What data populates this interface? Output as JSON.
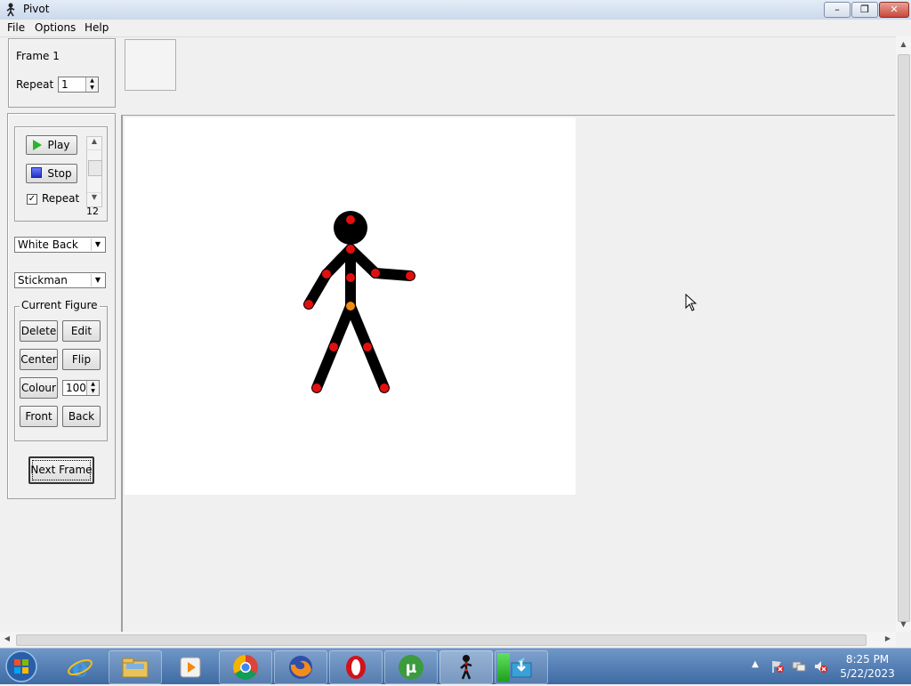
{
  "window": {
    "title": "Pivot"
  },
  "menu": {
    "items": [
      "File",
      "Options",
      "Help"
    ]
  },
  "frame_panel": {
    "frame_label": "Frame 1",
    "repeat_label": "Repeat :",
    "repeat_value": "1"
  },
  "playback": {
    "play_label": "Play",
    "stop_label": "Stop",
    "repeat_checkbox_label": "Repeat",
    "repeat_checked": true,
    "speed_value": "12"
  },
  "background_select": {
    "selected": "White Back"
  },
  "figure_type_select": {
    "selected": "Stickman"
  },
  "current_figure": {
    "group_label": "Current Figure",
    "delete_label": "Delete",
    "edit_label": "Edit",
    "center_label": "Center",
    "flip_label": "Flip",
    "colour_label": "Colour",
    "colour_value": "100",
    "front_label": "Front",
    "back_label": "Back"
  },
  "next_frame_label": "Next Frame",
  "taskbar": {
    "icons": [
      "start-orb-icon",
      "internet-explorer-icon",
      "file-explorer-icon",
      "media-player-icon",
      "chrome-icon",
      "firefox-icon",
      "opera-icon",
      "utorrent-icon",
      "pivot-icon",
      "download-manager-icon"
    ],
    "clock_time": "8:25 PM",
    "clock_date": "5/22/2023"
  },
  "colors": {
    "joint": "#e01010",
    "center_joint": "#f08a10",
    "figure": "#000000",
    "canvas": "#ffffff"
  }
}
